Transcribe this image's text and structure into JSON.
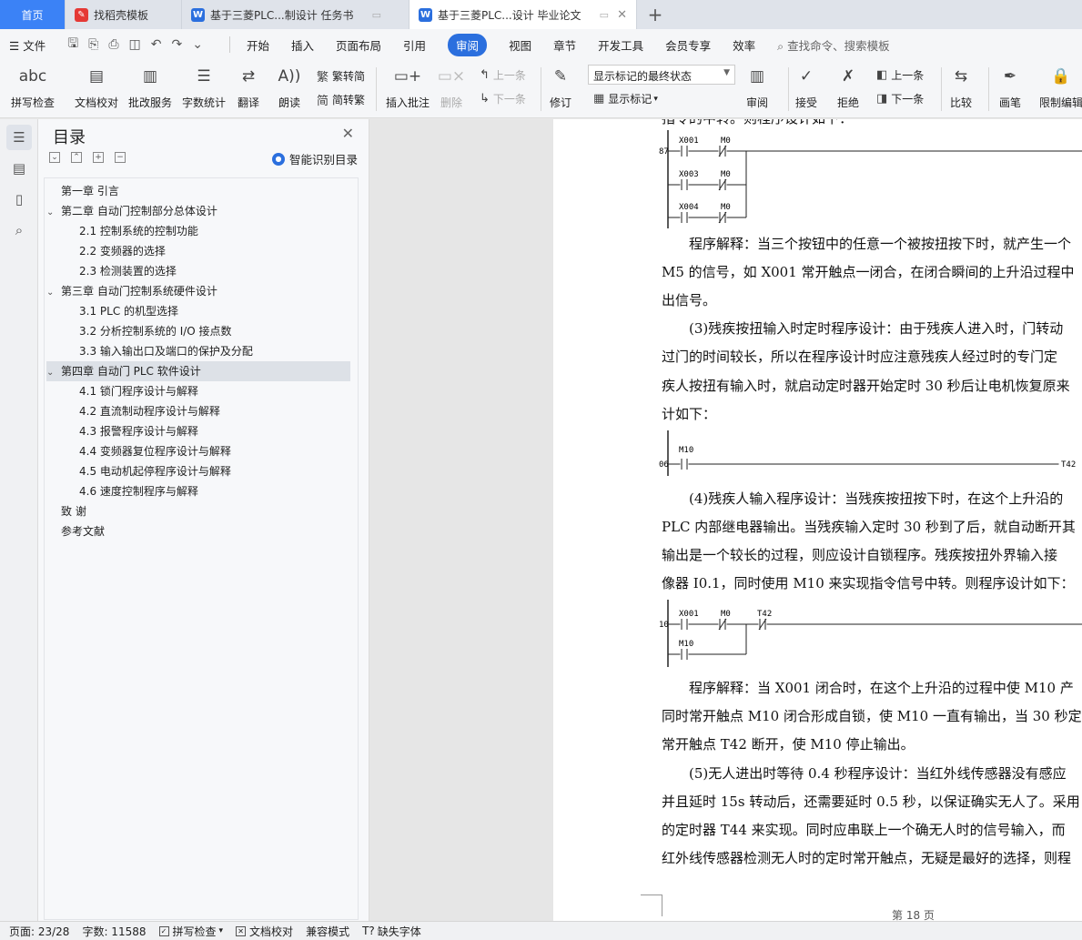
{
  "tabs": [
    {
      "label": "首页",
      "type": "home"
    },
    {
      "label": "找稻壳模板",
      "icon": "wps-red-icon"
    },
    {
      "label": "基于三菱PLC...制设计 任务书",
      "icon": "word-doc-icon"
    },
    {
      "label": "基于三菱PLC...设计 毕业论文",
      "icon": "word-doc-icon",
      "active": true
    }
  ],
  "menu": {
    "file": "文件",
    "items": [
      "开始",
      "插入",
      "页面布局",
      "引用",
      "审阅",
      "视图",
      "章节",
      "开发工具",
      "会员专享",
      "效率"
    ],
    "active": "审阅",
    "search_placeholder": "查找命令、搜索模板"
  },
  "ribbon": {
    "spellcheck": "拼写检查",
    "doccheck": "文档校对",
    "batch": "批改服务",
    "wordcount": "字数统计",
    "translate": "翻译",
    "read": "朗读",
    "trad": "繁转简",
    "simp": "简转繁",
    "insert_comment": "插入批注",
    "delete": "删除",
    "prev_comment": "上一条",
    "next_comment": "下一条",
    "track": "修订",
    "status_select": "显示标记的最终状态",
    "show_markup": "显示标记",
    "review": "审阅",
    "accept": "接受",
    "reject": "拒绝",
    "prev_change": "上一条",
    "next_change": "下一条",
    "compare": "比较",
    "pen": "画笔",
    "restrict": "限制编辑"
  },
  "toc": {
    "title": "目录",
    "smart": "智能识别目录",
    "items": [
      {
        "label": "第一章  引言",
        "level": 1,
        "chev": ""
      },
      {
        "label": "第二章  自动门控制部分总体设计",
        "level": 1,
        "chev": "v"
      },
      {
        "label": "2.1  控制系统的控制功能",
        "level": 2
      },
      {
        "label": "2.2  变频器的选择",
        "level": 2
      },
      {
        "label": "2.3  检测装置的选择",
        "level": 2
      },
      {
        "label": "第三章  自动门控制系统硬件设计",
        "level": 1,
        "chev": "v"
      },
      {
        "label": "3.1 PLC 的机型选择",
        "level": 2
      },
      {
        "label": "3.2 分析控制系统的 I/O 接点数",
        "level": 2
      },
      {
        "label": "3.3  输入输出口及端口的保护及分配",
        "level": 2
      },
      {
        "label": "第四章  自动门 PLC 软件设计",
        "level": 1,
        "chev": "v",
        "selected": true
      },
      {
        "label": "4.1 锁门程序设计与解释",
        "level": 2
      },
      {
        "label": "4.2 直流制动程序设计与解释",
        "level": 2
      },
      {
        "label": "4.3 报警程序设计与解释",
        "level": 2
      },
      {
        "label": "4.4 变频器复位程序设计与解释",
        "level": 2
      },
      {
        "label": "4.5 电动机起停程序设计与解释",
        "level": 2
      },
      {
        "label": "4.6 速度控制程序与解释",
        "level": 2
      },
      {
        "label": "致    谢",
        "level": 1,
        "chev": ""
      },
      {
        "label": "参考文献",
        "level": 1,
        "chev": ""
      }
    ]
  },
  "doc": {
    "top_partial": "指令的中转。则程序设计如下：",
    "paras": [
      "程序解释：当三个按钮中的任意一个被按扭按下时，就产生一个",
      "M5 的信号，如 X001 常开触点一闭合，在闭合瞬间的上升沿过程中",
      "出信号。",
      "(3)残疾按扭输入时定时程序设计：由于残疾人进入时，门转动",
      "过门的时间较长，所以在程序设计时应注意残疾人经过时的专门定",
      "疾人按扭有输入时，就启动定时器开始定时 30 秒后让电机恢复原来",
      "计如下：",
      "(4)残疾人输入程序设计：当残疾按扭按下时，在这个上升沿的",
      "PLC 内部继电器输出。当残疾输入定时 30 秒到了后，就自动断开其",
      "输出是一个较长的过程，则应设计自锁程序。残疾按扭外界输入接",
      "像器 I0.1，同时使用 M10 来实现指令信号中转。则程序设计如下：",
      "程序解释：当 X001 闭合时，在这个上升沿的过程中使 M10 产",
      "同时常开触点 M10 闭合形成自锁，使 M10 一直有输出，当 30 秒定",
      "常开触点 T42 断开，使 M10 停止输出。",
      "(5)无人进出时等待 0.4 秒程序设计：当红外线传感器没有感应",
      "并且延时 15s 转动后，还需要延时 0.5 秒，以保证确实无人了。采用",
      "的定时器 T44 来实现。同时应串联上一个确无人时的信号输入，而",
      "红外线传感器检测无人时的定时常开触点，无疑是最好的选择，则程"
    ],
    "ladder1": {
      "step": "87",
      "contacts": [
        "X001",
        "M0",
        "X003",
        "M0",
        "X004",
        "M0"
      ]
    },
    "ladder2": {
      "step": "06",
      "contacts": [
        "M10"
      ],
      "coil": "T42"
    },
    "ladder3": {
      "step": "10",
      "contacts": [
        "X001",
        "M0",
        "T42",
        "M10"
      ]
    },
    "page_label": "第 18 页"
  },
  "status": {
    "page": "页面: 23/28",
    "words": "字数: 11588",
    "spell": "拼写检查",
    "proof": "文档校对",
    "compat": "兼容模式",
    "missing_font": "缺失字体"
  }
}
